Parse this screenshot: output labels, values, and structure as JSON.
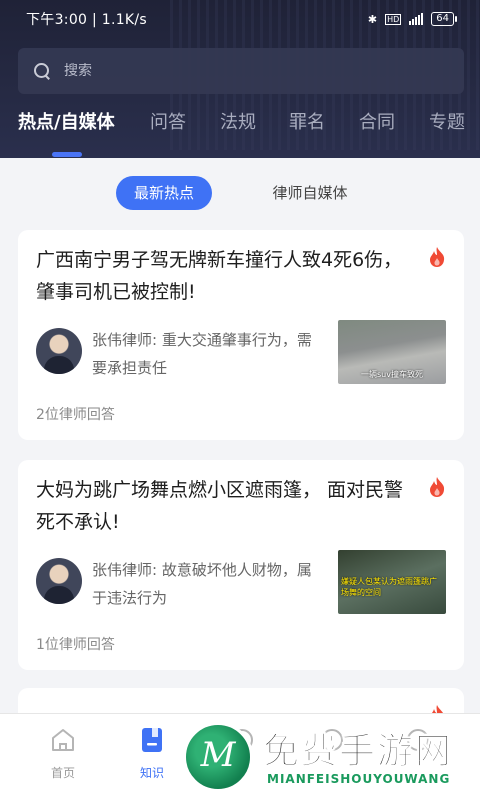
{
  "status_bar": {
    "time_speed": "下午3:00 | 1.1K/s",
    "battery": "64"
  },
  "search": {
    "placeholder": "搜索"
  },
  "tabs": [
    {
      "label": "热点/自媒体"
    },
    {
      "label": "问答"
    },
    {
      "label": "法规"
    },
    {
      "label": "罪名"
    },
    {
      "label": "合同"
    },
    {
      "label": "专题"
    }
  ],
  "segments": {
    "active": "最新热点",
    "inactive": "律师自媒体"
  },
  "posts": [
    {
      "title": "广西南宁男子驾无牌新车撞行人致4死6伤， 肇事司机已被控制!",
      "lawyer_text": "张伟律师: 重大交通肇事行为，需要承担责任",
      "answers": "2位律师回答",
      "thumb_caption": "一辆suv撞车致死"
    },
    {
      "title": "大妈为跳广场舞点燃小区遮雨篷， 面对民警死不承认!",
      "lawyer_text": "张伟律师: 故意破坏他人财物，属于违法行为",
      "answers": "1位律师回答",
      "thumb_caption": "嫌疑人包某认为遮雨篷跳广场舞的空间"
    }
  ],
  "bottom_nav": [
    {
      "label": "首页"
    },
    {
      "label": "知识"
    }
  ],
  "watermark": {
    "logo_letter": "M",
    "text": "免费手游网",
    "subtext": "MIANFEISHOUYOUWANG"
  },
  "colors": {
    "accent": "#3f72f5",
    "header_bg": "#232640",
    "fire": "#f04a35"
  }
}
